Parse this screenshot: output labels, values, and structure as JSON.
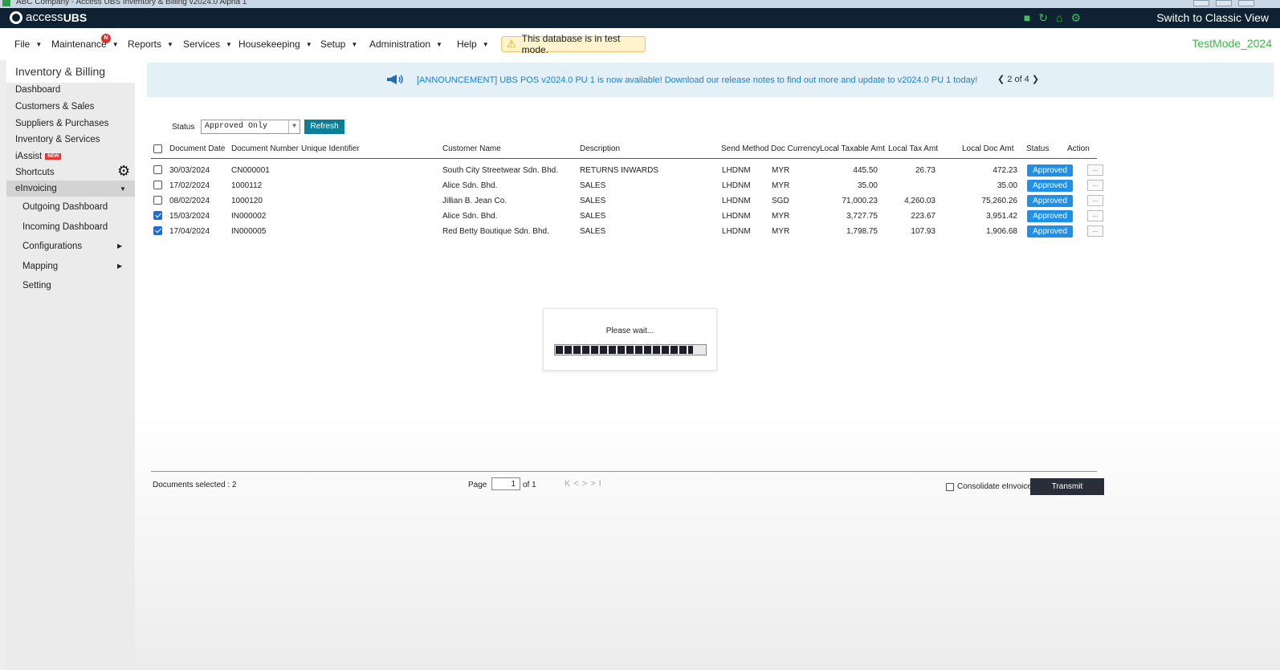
{
  "window": {
    "title": "ABC Company - Access UBS Inventory & Billing v2024.0 Alpha 1"
  },
  "header": {
    "logo_prefix": "access",
    "logo_brand": "UBS",
    "switch_view": "Switch to Classic View",
    "test_mode": "TestMode_2024"
  },
  "menu": {
    "file": "File",
    "maintenance": "Maintenance",
    "maintenance_badge": "N",
    "reports": "Reports",
    "services": "Services",
    "housekeeping": "Housekeeping",
    "setup": "Setup",
    "administration": "Administration",
    "help": "Help",
    "test_warning": "This database is in test mode."
  },
  "sidebar": {
    "title": "Inventory & Billing",
    "dashboard": "Dashboard",
    "customers_sales": "Customers & Sales",
    "suppliers_purchases": "Suppliers & Purchases",
    "inventory_services": "Inventory & Services",
    "iassist": "iAssist",
    "new_badge": "NEW",
    "shortcuts": "Shortcuts",
    "einvoicing": "eInvoicing",
    "outgoing_dashboard": "Outgoing Dashboard",
    "incoming_dashboard": "Incoming Dashboard",
    "configurations": "Configurations",
    "mapping": "Mapping",
    "setting": "Setting"
  },
  "announcement": {
    "text": "[ANNOUNCEMENT] UBS POS v2024.0 PU 1 is now available! Download our release notes to find out more and update to v2024.0 PU 1 today!",
    "pager": "2 of 4"
  },
  "filter": {
    "status_label": "Status",
    "status_value": "Approved Only",
    "refresh_label": "Refresh"
  },
  "table": {
    "headers": {
      "doc_date": "Document Date",
      "doc_number": "Document Number",
      "unique_id": "Unique Identifier",
      "customer": "Customer Name",
      "description": "Description",
      "send_method": "Send Method",
      "doc_currency": "Doc Currency",
      "taxable": "Local Taxable Amt",
      "tax": "Local Tax Amt",
      "doc_amt": "Local Doc Amt",
      "status": "Status",
      "action": "Action"
    },
    "rows": [
      {
        "checked": false,
        "date": "30/03/2024",
        "number": "CN000001",
        "uid": "",
        "customer": "South City Streetwear Sdn. Bhd.",
        "description": "RETURNS INWARDS",
        "send": "LHDNM",
        "currency": "MYR",
        "taxable": "445.50",
        "tax": "26.73",
        "doc": "472.23",
        "status": "Approved",
        "action": "..."
      },
      {
        "checked": false,
        "date": "17/02/2024",
        "number": "1000112",
        "uid": "",
        "customer": "Alice Sdn. Bhd.",
        "description": "SALES",
        "send": "LHDNM",
        "currency": "MYR",
        "taxable": "35.00",
        "tax": "",
        "doc": "35.00",
        "status": "Approved",
        "action": "..."
      },
      {
        "checked": false,
        "date": "08/02/2024",
        "number": "1000120",
        "uid": "",
        "customer": "Jillian B. Jean Co.",
        "description": "SALES",
        "send": "LHDNM",
        "currency": "SGD",
        "taxable": "71,000.23",
        "tax": "4,260.03",
        "doc": "75,260.26",
        "status": "Approved",
        "action": "..."
      },
      {
        "checked": true,
        "date": "15/03/2024",
        "number": "IN000002",
        "uid": "",
        "customer": "Alice Sdn. Bhd.",
        "description": "SALES",
        "send": "LHDNM",
        "currency": "MYR",
        "taxable": "3,727.75",
        "tax": "223.67",
        "doc": "3,951.42",
        "status": "Approved",
        "action": "..."
      },
      {
        "checked": true,
        "date": "17/04/2024",
        "number": "IN000005",
        "uid": "",
        "customer": "Red Betty Boutique Sdn. Bhd.",
        "description": "SALES",
        "send": "LHDNM",
        "currency": "MYR",
        "taxable": "1,798.75",
        "tax": "107.93",
        "doc": "1,906.68",
        "status": "Approved",
        "action": "..."
      }
    ]
  },
  "wait_dialog": {
    "message": "Please wait...",
    "progress": 0.92
  },
  "footer": {
    "docs_selected": "Documents selected : 2",
    "page_label": "Page",
    "page_value": "1",
    "of_label": "of 1",
    "consolidate_label": "Consolidate eInvoice",
    "transmit_label": "Transmit"
  },
  "colors": {
    "header_bg": "#0e2233",
    "accent_green": "#3fb54a",
    "approved_blue": "#1e90e8",
    "refresh_teal": "#0a7f95",
    "transmit_dark": "#2a2e38"
  }
}
